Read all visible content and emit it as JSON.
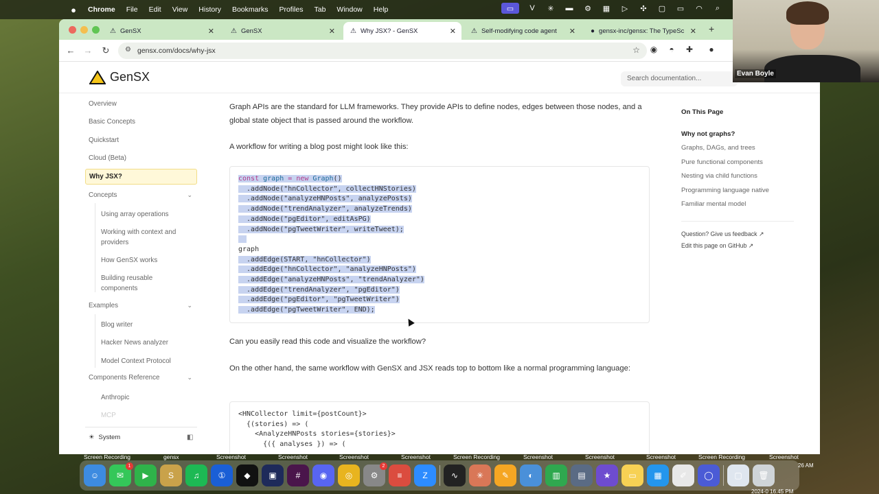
{
  "menubar": {
    "app": "Chrome",
    "items": [
      "File",
      "Edit",
      "View",
      "History",
      "Bookmarks",
      "Profiles",
      "Tab",
      "Window",
      "Help"
    ]
  },
  "browser": {
    "tabs": [
      {
        "label": "GenSX",
        "icon": "gensx-triangle-icon"
      },
      {
        "label": "GenSX",
        "icon": "gensx-triangle-icon"
      },
      {
        "label": "Why JSX? - GenSX",
        "icon": "gensx-triangle-icon"
      },
      {
        "label": "Self-modifying code agent",
        "icon": "gensx-triangle-icon"
      },
      {
        "label": "gensx-inc/gensx: The TypeSc",
        "icon": "github-icon"
      }
    ],
    "new_tab": "+",
    "url": "gensx.com/docs/why-jsx"
  },
  "site": {
    "logo": "GenSX",
    "search_placeholder": "Search documentation..."
  },
  "sidebar": {
    "items": {
      "overview": "Overview",
      "basic": "Basic Concepts",
      "quickstart": "Quickstart",
      "cloud": "Cloud (Beta)",
      "why": "Why JSX?",
      "concepts": "Concepts",
      "array": "Using array operations",
      "context": "Working with context and providers",
      "how": "How GenSX works",
      "reusable": "Building reusable components",
      "examples": "Examples",
      "blog": "Blog writer",
      "hn": "Hacker News analyzer",
      "mcp": "Model Context Protocol",
      "components": "Components Reference",
      "anthropic": "Anthropic",
      "mcp2": "MCP"
    },
    "theme": "System"
  },
  "content": {
    "p1": "Graph APIs are the standard for LLM frameworks. They provide APIs to define nodes, edges between those nodes, and a global state object that is passed around the workflow.",
    "p2": "A workflow for writing a blog post might look like this:",
    "code1": [
      "const graph = new Graph()",
      "  .addNode(\"hnCollector\", collectHNStories)",
      "  .addNode(\"analyzeHNPosts\", analyzePosts)",
      "  .addNode(\"trendAnalyzer\", analyzeTrends)",
      "  .addNode(\"pgEditor\", editAsPG)",
      "  .addNode(\"pgTweetWriter\", writeTweet);",
      "",
      "graph",
      "  .addEdge(START, \"hnCollector\")",
      "  .addEdge(\"hnCollector\", \"analyzeHNPosts\")",
      "  .addEdge(\"analyzeHNPosts\", \"trendAnalyzer\")",
      "  .addEdge(\"trendAnalyzer\", \"pgEditor\")",
      "  .addEdge(\"pgEditor\", \"pgTweetWriter\")",
      "  .addEdge(\"pgTweetWriter\", END);"
    ],
    "p3": "Can you easily read this code and visualize the workflow?",
    "p4": "On the other hand, the same workflow with GenSX and JSX reads top to bottom like a normal programming language:",
    "code2": [
      "<HNCollector limit={postCount}>",
      "  {(stories) => (",
      "    <AnalyzeHNPosts stories={stories}>",
      "      {({ analyses }) => ("
    ]
  },
  "toc": {
    "title": "On This Page",
    "items": [
      "Why not graphs?",
      "Graphs, DAGs, and trees",
      "Pure functional components",
      "Nesting via child functions",
      "Programming language native",
      "Familiar mental model"
    ],
    "feedback": "Question? Give us feedback ↗",
    "edit": "Edit this page on GitHub ↗"
  },
  "webcam": {
    "name": "Evan Boyle"
  },
  "dock": {
    "labels": [
      "Screen Recording",
      "gensx",
      "Screenshot",
      "Screenshot",
      "Screenshot",
      "Screenshot",
      "Screen Recording",
      "Screenshot",
      "Screenshot",
      "Screenshot",
      "Screen Recording",
      "Screenshot"
    ],
    "apps": [
      {
        "name": "finder-icon",
        "color": "#3d8be0",
        "glyph": "☺"
      },
      {
        "name": "messages-icon",
        "color": "#34c759",
        "glyph": "✉",
        "badge": "1"
      },
      {
        "name": "facetime-icon",
        "color": "#2fb34a",
        "glyph": "▶"
      },
      {
        "name": "sonos-icon",
        "color": "#c9a24a",
        "glyph": "S"
      },
      {
        "name": "spotify-icon",
        "color": "#1db954",
        "glyph": "♫"
      },
      {
        "name": "1password-icon",
        "color": "#1a5fd6",
        "glyph": "①"
      },
      {
        "name": "cursor-app-icon",
        "color": "#111111",
        "glyph": "◆"
      },
      {
        "name": "vscode-icon",
        "color": "#1e2a5a",
        "glyph": "▣"
      },
      {
        "name": "slack-icon",
        "color": "#4a154b",
        "glyph": "#"
      },
      {
        "name": "discord-icon",
        "color": "#5865f2",
        "glyph": "◉"
      },
      {
        "name": "chrome-icon",
        "color": "#e8b41f",
        "glyph": "◎"
      },
      {
        "name": "system-settings-icon",
        "color": "#888888",
        "glyph": "⚙",
        "badge": "2"
      },
      {
        "name": "todoist-icon",
        "color": "#db4c3f",
        "glyph": "≡"
      },
      {
        "name": "zoom-icon",
        "color": "#2d8cff",
        "glyph": "Z"
      },
      {
        "name": "activity-monitor-icon",
        "color": "#222222",
        "glyph": "∿"
      },
      {
        "name": "claude-icon",
        "color": "#d97757",
        "glyph": "✳"
      },
      {
        "name": "pencil-app-icon",
        "color": "#f5a623",
        "glyph": "✎"
      },
      {
        "name": "proxyman-icon",
        "color": "#4a90d9",
        "glyph": "◐"
      },
      {
        "name": "numbers-icon",
        "color": "#2fa84f",
        "glyph": "▥"
      },
      {
        "name": "xcode-simulator-icon",
        "color": "#5a6b84",
        "glyph": "▤"
      },
      {
        "name": "imovie-icon",
        "color": "#6e4ccf",
        "glyph": "★"
      },
      {
        "name": "notes-icon",
        "color": "#f7d154",
        "glyph": "▭"
      },
      {
        "name": "docker-icon",
        "color": "#2496ed",
        "glyph": "▦"
      },
      {
        "name": "textedit-icon",
        "color": "#e8e8e8",
        "glyph": "✐"
      },
      {
        "name": "warp-icon",
        "color": "#4b5bd6",
        "glyph": "◯"
      },
      {
        "name": "preview-icon",
        "color": "#dfe6ef",
        "glyph": "▢"
      },
      {
        "name": "trash-icon",
        "color": "#cfd4d8",
        "glyph": "🗑"
      }
    ],
    "clock_a": "26 AM",
    "clock_b": "2024-0  16.45 PM"
  }
}
